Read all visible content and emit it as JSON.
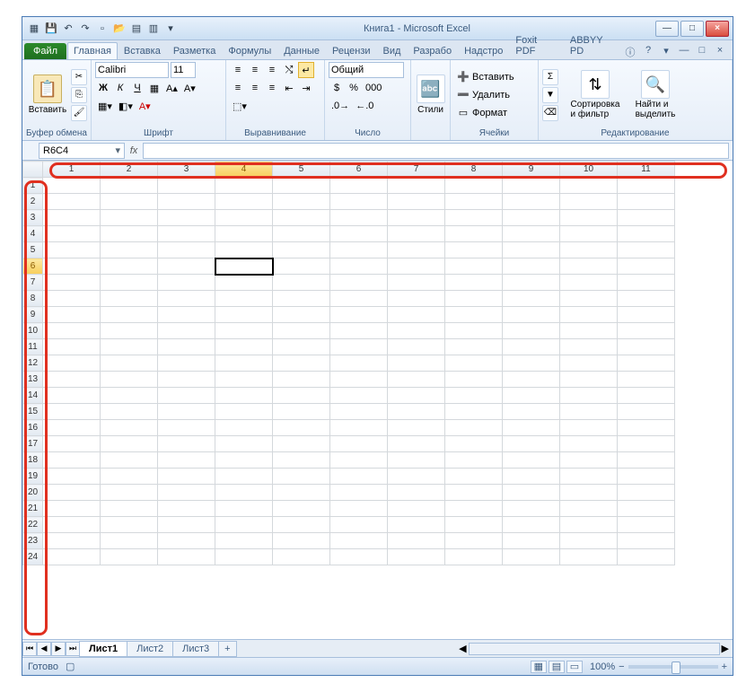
{
  "title": "Книга1 - Microsoft Excel",
  "qat": [
    "xl",
    "save",
    "undo",
    "redo",
    "new",
    "open",
    "print",
    "preview",
    "quick"
  ],
  "winbtns": {
    "min": "—",
    "max": "□",
    "close": "×"
  },
  "tabs": {
    "file": "Файл",
    "items": [
      "Главная",
      "Вставка",
      "Разметка",
      "Формулы",
      "Данные",
      "Рецензи",
      "Вид",
      "Разрабо",
      "Надстро",
      "Foxit PDF",
      "ABBYY PD"
    ],
    "active": 0
  },
  "help_icons": [
    "ⓘ",
    "?",
    "▾",
    "—",
    "□",
    "×"
  ],
  "ribbon": {
    "clipboard": {
      "paste": "Вставить",
      "label": "Буфер обмена"
    },
    "font": {
      "name": "Calibri",
      "size": "11",
      "label": "Шрифт",
      "bold": "Ж",
      "italic": "К",
      "underline": "Ч"
    },
    "align": {
      "label": "Выравнивание"
    },
    "number": {
      "format": "Общий",
      "label": "Число"
    },
    "styles": {
      "btn": "Стили",
      "label": ""
    },
    "cells": {
      "insert": "Вставить",
      "delete": "Удалить",
      "format": "Формат",
      "label": "Ячейки"
    },
    "editing": {
      "sort": "Сортировка\nи фильтр",
      "find": "Найти и\nвыделить",
      "label": "Редактирование"
    }
  },
  "namebox": "R6C4",
  "fx": "fx",
  "columns": [
    "1",
    "2",
    "3",
    "4",
    "5",
    "6",
    "7",
    "8",
    "9",
    "10",
    "11"
  ],
  "rows": [
    "1",
    "2",
    "3",
    "4",
    "5",
    "6",
    "7",
    "8",
    "9",
    "10",
    "11",
    "12",
    "13",
    "14",
    "15",
    "16",
    "17",
    "18",
    "19",
    "20",
    "21",
    "22",
    "23",
    "24"
  ],
  "selected": {
    "row": 6,
    "col": 4
  },
  "sheets": {
    "list": [
      "Лист1",
      "Лист2",
      "Лист3"
    ],
    "active": 0,
    "new": "+"
  },
  "status": {
    "ready": "Готово",
    "zoom": "100%",
    "minus": "−",
    "plus": "+"
  }
}
